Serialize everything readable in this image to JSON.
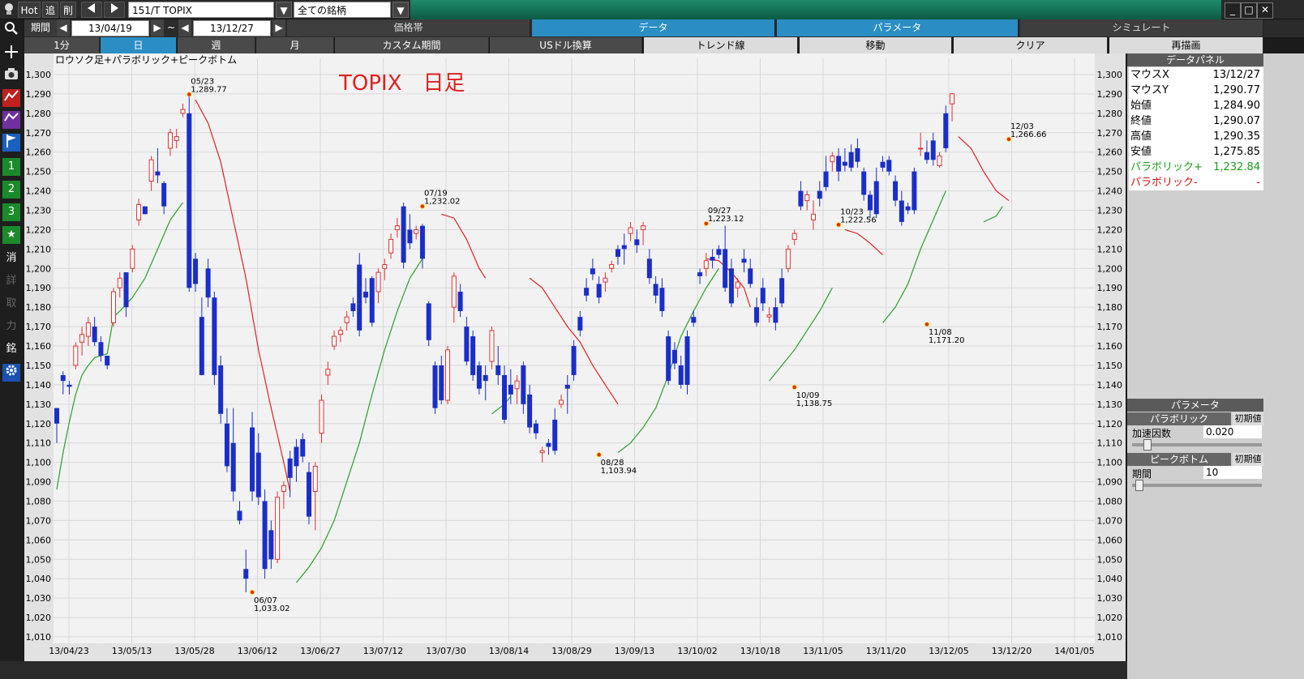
{
  "toolbar": {
    "hot_label": "Hot",
    "add_label": "追",
    "del_label": "削",
    "prev_icon": "triangle-left-icon",
    "next_icon": "triangle-right-icon",
    "symbol_value": "151/T TOPIX",
    "list_value": "全ての銘柄"
  },
  "period": {
    "label": "期間",
    "from": "13/04/19",
    "tilde": "~",
    "to": "13/12/27"
  },
  "sections": [
    "価格帯",
    "データ",
    "パラメータ",
    "シミュレート"
  ],
  "selected_section": "データ",
  "interval_tabs": [
    "1分",
    "日",
    "週",
    "月",
    "カスタム期間",
    "USドル換算",
    "トレンド線",
    "移動",
    "クリア",
    "再描画"
  ],
  "selected_interval": "日",
  "left_toolbar": [
    "1",
    "2",
    "3",
    "消",
    "詳",
    "取",
    "力",
    "銘"
  ],
  "chart_header": "ロウソク足+パラボリック+ピークボトム",
  "chart_data": {
    "type": "candlestick",
    "title": "TOPIX　日足",
    "ylim": [
      1010,
      1300
    ],
    "y_ticks": [
      1010,
      1020,
      1030,
      1040,
      1050,
      1060,
      1070,
      1080,
      1090,
      1100,
      1110,
      1120,
      1130,
      1140,
      1150,
      1160,
      1170,
      1180,
      1190,
      1200,
      1210,
      1220,
      1230,
      1240,
      1250,
      1260,
      1270,
      1280,
      1290,
      1300
    ],
    "y_tick_labels": [
      "1,010",
      "1,020",
      "1,030",
      "1,040",
      "1,050",
      "1,060",
      "1,070",
      "1,080",
      "1,090",
      "1,100",
      "1,110",
      "1,120",
      "1,130",
      "1,140",
      "1,150",
      "1,160",
      "1,170",
      "1,180",
      "1,190",
      "1,200",
      "1,210",
      "1,220",
      "1,230",
      "1,240",
      "1,250",
      "1,260",
      "1,270",
      "1,280",
      "1,290",
      "1,300"
    ],
    "x_tick_labels": [
      "13/04/23",
      "13/05/13",
      "13/05/28",
      "13/06/12",
      "13/06/27",
      "13/07/12",
      "13/07/30",
      "13/08/14",
      "13/08/29",
      "13/09/13",
      "13/10/02",
      "13/10/18",
      "13/11/05",
      "13/11/20",
      "13/12/05",
      "13/12/20",
      "14/01/05"
    ],
    "candles": [
      [
        1128,
        1128,
        1110,
        1120
      ],
      [
        1145,
        1147,
        1135,
        1142
      ],
      [
        1140,
        1142,
        1135,
        1139
      ],
      [
        1150,
        1162,
        1148,
        1160
      ],
      [
        1162,
        1170,
        1155,
        1166
      ],
      [
        1165,
        1175,
        1160,
        1172
      ],
      [
        1170,
        1175,
        1160,
        1162
      ],
      [
        1162,
        1165,
        1152,
        1155
      ],
      [
        1155,
        1152,
        1148,
        1150
      ],
      [
        1172,
        1190,
        1170,
        1188
      ],
      [
        1190,
        1198,
        1185,
        1195
      ],
      [
        1198,
        1175,
        1195,
        1180
      ],
      [
        1200,
        1212,
        1198,
        1210
      ],
      [
        1225,
        1236,
        1222,
        1233
      ],
      [
        1232,
        1232,
        1228,
        1228
      ],
      [
        1245,
        1258,
        1240,
        1256
      ],
      [
        1250,
        1262,
        1244,
        1248
      ],
      [
        1244,
        1245,
        1228,
        1232
      ],
      [
        1262,
        1272,
        1258,
        1270
      ],
      [
        1266,
        1272,
        1262,
        1268
      ],
      [
        1280,
        1285,
        1278,
        1282
      ],
      [
        1280,
        1290,
        1188,
        1190
      ],
      [
        1205,
        1208,
        1188,
        1192
      ],
      [
        1175,
        1185,
        1145,
        1145
      ],
      [
        1200,
        1205,
        1180,
        1185
      ],
      [
        1185,
        1188,
        1140,
        1145
      ],
      [
        1150,
        1155,
        1120,
        1125
      ],
      [
        1120,
        1128,
        1095,
        1098
      ],
      [
        1110,
        1128,
        1080,
        1085
      ],
      [
        1075,
        1080,
        1068,
        1070
      ],
      [
        1045,
        1055,
        1033,
        1040
      ],
      [
        1118,
        1126,
        1080,
        1085
      ],
      [
        1105,
        1115,
        1078,
        1082
      ],
      [
        1080,
        1086,
        1040,
        1045
      ],
      [
        1065,
        1070,
        1045,
        1050
      ],
      [
        1050,
        1085,
        1048,
        1082
      ],
      [
        1085,
        1090,
        1076,
        1088
      ],
      [
        1102,
        1106,
        1082,
        1092
      ],
      [
        1108,
        1112,
        1090,
        1098
      ],
      [
        1112,
        1115,
        1100,
        1103
      ],
      [
        1095,
        1100,
        1068,
        1072
      ],
      [
        1085,
        1100,
        1065,
        1098
      ],
      [
        1115,
        1135,
        1110,
        1132
      ],
      [
        1145,
        1152,
        1140,
        1148
      ],
      [
        1160,
        1168,
        1158,
        1165
      ],
      [
        1166,
        1170,
        1162,
        1168
      ],
      [
        1172,
        1178,
        1168,
        1175
      ],
      [
        1182,
        1185,
        1175,
        1178
      ],
      [
        1202,
        1208,
        1165,
        1168
      ],
      [
        1188,
        1195,
        1182,
        1185
      ],
      [
        1195,
        1196,
        1170,
        1172
      ],
      [
        1188,
        1200,
        1182,
        1198
      ],
      [
        1200,
        1205,
        1194,
        1202
      ],
      [
        1208,
        1218,
        1205,
        1215
      ],
      [
        1220,
        1226,
        1216,
        1222
      ],
      [
        1232,
        1234,
        1200,
        1203
      ],
      [
        1220,
        1228,
        1210,
        1213
      ],
      [
        1218,
        1222,
        1215,
        1220
      ],
      [
        1222,
        1223,
        1200,
        1205
      ],
      [
        1182,
        1183,
        1160,
        1163
      ],
      [
        1150,
        1152,
        1125,
        1128
      ],
      [
        1150,
        1155,
        1130,
        1132
      ],
      [
        1132,
        1160,
        1130,
        1158
      ],
      [
        1180,
        1198,
        1172,
        1196
      ],
      [
        1188,
        1192,
        1175,
        1178
      ],
      [
        1170,
        1175,
        1150,
        1152
      ],
      [
        1165,
        1168,
        1142,
        1145
      ],
      [
        1150,
        1152,
        1135,
        1138
      ],
      [
        1145,
        1150,
        1132,
        1142
      ],
      [
        1152,
        1170,
        1148,
        1168
      ],
      [
        1150,
        1160,
        1140,
        1145
      ],
      [
        1145,
        1150,
        1120,
        1122
      ],
      [
        1140,
        1148,
        1130,
        1135
      ],
      [
        1138,
        1145,
        1130,
        1142
      ],
      [
        1150,
        1152,
        1125,
        1130
      ],
      [
        1135,
        1140,
        1115,
        1118
      ],
      [
        1120,
        1122,
        1112,
        1115
      ],
      [
        1105,
        1108,
        1100,
        1106
      ],
      [
        1110,
        1112,
        1104,
        1108
      ],
      [
        1122,
        1128,
        1104,
        1106
      ],
      [
        1130,
        1135,
        1128,
        1132
      ],
      [
        1140,
        1145,
        1125,
        1138
      ],
      [
        1160,
        1163,
        1142,
        1145
      ],
      [
        1175,
        1178,
        1165,
        1168
      ],
      [
        1190,
        1195,
        1183,
        1186
      ],
      [
        1200,
        1205,
        1194,
        1197
      ],
      [
        1192,
        1196,
        1182,
        1185
      ],
      [
        1193,
        1198,
        1188,
        1195
      ],
      [
        1200,
        1204,
        1198,
        1202
      ],
      [
        1210,
        1212,
        1202,
        1206
      ],
      [
        1212,
        1218,
        1202,
        1210
      ],
      [
        1218,
        1224,
        1214,
        1221
      ],
      [
        1215,
        1220,
        1208,
        1212
      ],
      [
        1220,
        1224,
        1212,
        1222
      ],
      [
        1205,
        1210,
        1192,
        1195
      ],
      [
        1192,
        1196,
        1182,
        1186
      ],
      [
        1190,
        1195,
        1175,
        1178
      ],
      [
        1165,
        1168,
        1140,
        1142
      ],
      [
        1158,
        1162,
        1148,
        1151
      ],
      [
        1150,
        1155,
        1138,
        1140
      ],
      [
        1165,
        1168,
        1135,
        1140
      ],
      [
        1175,
        1178,
        1170,
        1172
      ],
      [
        1198,
        1200,
        1192,
        1196
      ],
      [
        1200,
        1208,
        1196,
        1204
      ],
      [
        1206,
        1210,
        1200,
        1204
      ],
      [
        1210,
        1212,
        1205,
        1207
      ],
      [
        1210,
        1222,
        1188,
        1190
      ],
      [
        1200,
        1205,
        1180,
        1182
      ],
      [
        1190,
        1195,
        1185,
        1193
      ],
      [
        1205,
        1210,
        1198,
        1203
      ],
      [
        1200,
        1205,
        1190,
        1192
      ],
      [
        1180,
        1185,
        1170,
        1172
      ],
      [
        1190,
        1195,
        1178,
        1182
      ],
      [
        1175,
        1180,
        1172,
        1176
      ],
      [
        1180,
        1185,
        1168,
        1172
      ],
      [
        1195,
        1200,
        1180,
        1182
      ],
      [
        1200,
        1212,
        1198,
        1210
      ],
      [
        1215,
        1220,
        1212,
        1218
      ],
      [
        1240,
        1245,
        1230,
        1232
      ],
      [
        1235,
        1240,
        1230,
        1238
      ],
      [
        1225,
        1235,
        1220,
        1228
      ],
      [
        1240,
        1245,
        1232,
        1236
      ],
      [
        1250,
        1258,
        1240,
        1242
      ],
      [
        1255,
        1260,
        1250,
        1258
      ],
      [
        1258,
        1262,
        1245,
        1250
      ],
      [
        1255,
        1262,
        1250,
        1253
      ],
      [
        1260,
        1264,
        1250,
        1252
      ],
      [
        1262,
        1267,
        1252,
        1255
      ],
      [
        1250,
        1252,
        1235,
        1238
      ],
      [
        1238,
        1240,
        1226,
        1230
      ],
      [
        1245,
        1252,
        1226,
        1228
      ],
      [
        1255,
        1258,
        1250,
        1252
      ],
      [
        1256,
        1258,
        1248,
        1250
      ],
      [
        1245,
        1248,
        1232,
        1235
      ],
      [
        1235,
        1240,
        1222,
        1224
      ],
      [
        1232,
        1234,
        1228,
        1230
      ],
      [
        1250,
        1252,
        1228,
        1230
      ],
      [
        1262,
        1270,
        1258,
        1262
      ],
      [
        1260,
        1266,
        1254,
        1256
      ],
      [
        1266,
        1270,
        1253,
        1256
      ],
      [
        1253,
        1260,
        1252,
        1258
      ],
      [
        1280,
        1284,
        1260,
        1262
      ],
      [
        1284.9,
        1290.35,
        1275.85,
        1290.07
      ]
    ],
    "parabolic_up": [
      [
        [
          0,
          1086
        ],
        [
          1,
          1105
        ],
        [
          2,
          1121
        ],
        [
          3,
          1135
        ],
        [
          4,
          1145
        ],
        [
          5,
          1150
        ],
        [
          6,
          1154
        ],
        [
          8,
          1156
        ],
        [
          9,
          1175
        ],
        [
          10,
          1178
        ],
        [
          12,
          1185
        ],
        [
          14,
          1195
        ],
        [
          16,
          1210
        ],
        [
          18,
          1225
        ],
        [
          20,
          1234
        ]
      ],
      [
        [
          38,
          1038
        ],
        [
          40,
          1046
        ],
        [
          42,
          1056
        ],
        [
          44,
          1070
        ],
        [
          46,
          1090
        ],
        [
          48,
          1110
        ],
        [
          50,
          1135
        ],
        [
          52,
          1158
        ],
        [
          54,
          1178
        ],
        [
          56,
          1195
        ],
        [
          58,
          1205
        ]
      ],
      [
        [
          69,
          1125
        ],
        [
          71,
          1130
        ],
        [
          72,
          1134
        ]
      ],
      [
        [
          89,
          1105
        ],
        [
          91,
          1110
        ],
        [
          93,
          1118
        ],
        [
          95,
          1128
        ],
        [
          97,
          1145
        ],
        [
          99,
          1165
        ],
        [
          101,
          1178
        ],
        [
          103,
          1190
        ],
        [
          105,
          1200
        ]
      ],
      [
        [
          113,
          1142
        ],
        [
          115,
          1150
        ],
        [
          117,
          1158
        ],
        [
          119,
          1168
        ],
        [
          121,
          1178
        ],
        [
          123,
          1190
        ]
      ],
      [
        [
          131,
          1172
        ],
        [
          133,
          1180
        ],
        [
          135,
          1192
        ],
        [
          137,
          1210
        ],
        [
          139,
          1225
        ],
        [
          141,
          1240
        ]
      ],
      [
        [
          147,
          1224
        ],
        [
          149,
          1227
        ],
        [
          150,
          1232
        ]
      ]
    ],
    "parabolic_down": [
      [
        [
          22,
          1287
        ],
        [
          24,
          1275
        ],
        [
          26,
          1255
        ],
        [
          28,
          1225
        ],
        [
          30,
          1195
        ],
        [
          32,
          1158
        ],
        [
          34,
          1128
        ],
        [
          36,
          1100
        ],
        [
          37,
          1085
        ]
      ],
      [
        [
          61,
          1228
        ],
        [
          63,
          1226
        ],
        [
          65,
          1215
        ],
        [
          67,
          1200
        ],
        [
          68,
          1195
        ]
      ],
      [
        [
          75,
          1195
        ],
        [
          77,
          1190
        ],
        [
          79,
          1180
        ],
        [
          81,
          1170
        ],
        [
          83,
          1162
        ],
        [
          85,
          1150
        ],
        [
          87,
          1140
        ],
        [
          89,
          1130
        ]
      ],
      [
        [
          103,
          1205
        ],
        [
          105,
          1204
        ],
        [
          107,
          1198
        ],
        [
          109,
          1190
        ],
        [
          110,
          1180
        ]
      ],
      [
        [
          125,
          1220
        ],
        [
          127,
          1218
        ],
        [
          129,
          1213
        ],
        [
          131,
          1207
        ]
      ],
      [
        [
          143,
          1268
        ],
        [
          145,
          1262
        ],
        [
          147,
          1250
        ],
        [
          149,
          1240
        ],
        [
          151,
          1235
        ]
      ]
    ],
    "peaks": [
      {
        "idx": 21,
        "value": 1289.77,
        "date": "05/23",
        "value_label": "1,289.77",
        "pos": "above"
      },
      {
        "idx": 31,
        "value": 1033.02,
        "date": "06/07",
        "value_label": "1,033.02",
        "pos": "below"
      },
      {
        "idx": 58,
        "value": 1232.02,
        "date": "07/19",
        "value_label": "1,232.02",
        "pos": "above"
      },
      {
        "idx": 86,
        "value": 1103.94,
        "date": "08/28",
        "value_label": "1,103.94",
        "pos": "below"
      },
      {
        "idx": 103,
        "value": 1223.12,
        "date": "09/27",
        "value_label": "1,223.12",
        "pos": "above"
      },
      {
        "idx": 117,
        "value": 1138.75,
        "date": "10/09",
        "value_label": "1,138.75",
        "pos": "below"
      },
      {
        "idx": 124,
        "value": 1222.56,
        "date": "10/23",
        "value_label": "1,222.56",
        "pos": "above"
      },
      {
        "idx": 138,
        "value": 1171.2,
        "date": "11/08",
        "value_label": "1,171.20",
        "pos": "below"
      },
      {
        "idx": 151,
        "value": 1266.66,
        "date": "12/03",
        "value_label": "1,266.66",
        "pos": "above"
      }
    ],
    "colors": {
      "up": "#e03030",
      "down": "#1a2ec8",
      "parabolic_up": "#2aa02a",
      "parabolic_down": "#e02020",
      "peak_dot": "#e03000",
      "title": "#e02020"
    }
  },
  "data_panel": {
    "title": "データパネル",
    "rows": [
      {
        "k": "マウスX",
        "v": "13/12/27"
      },
      {
        "k": "マウスY",
        "v": "1,290.77"
      },
      {
        "k": "始値",
        "v": "1,284.90"
      },
      {
        "k": "終値",
        "v": "1,290.07"
      },
      {
        "k": "高値",
        "v": "1,290.35"
      },
      {
        "k": "安値",
        "v": "1,275.85"
      },
      {
        "k": "パラボリック+",
        "v": "1,232.84"
      },
      {
        "k": "パラボリック-",
        "v": "-"
      }
    ]
  },
  "param_panel": {
    "title": "パラメータ",
    "parabolic_label": "パラボリック",
    "reset_label": "初期値",
    "accel_label": "加速因数",
    "accel_value": "0.020",
    "peak_label": "ピークボトム",
    "period_label": "期間",
    "period_value": "10"
  }
}
